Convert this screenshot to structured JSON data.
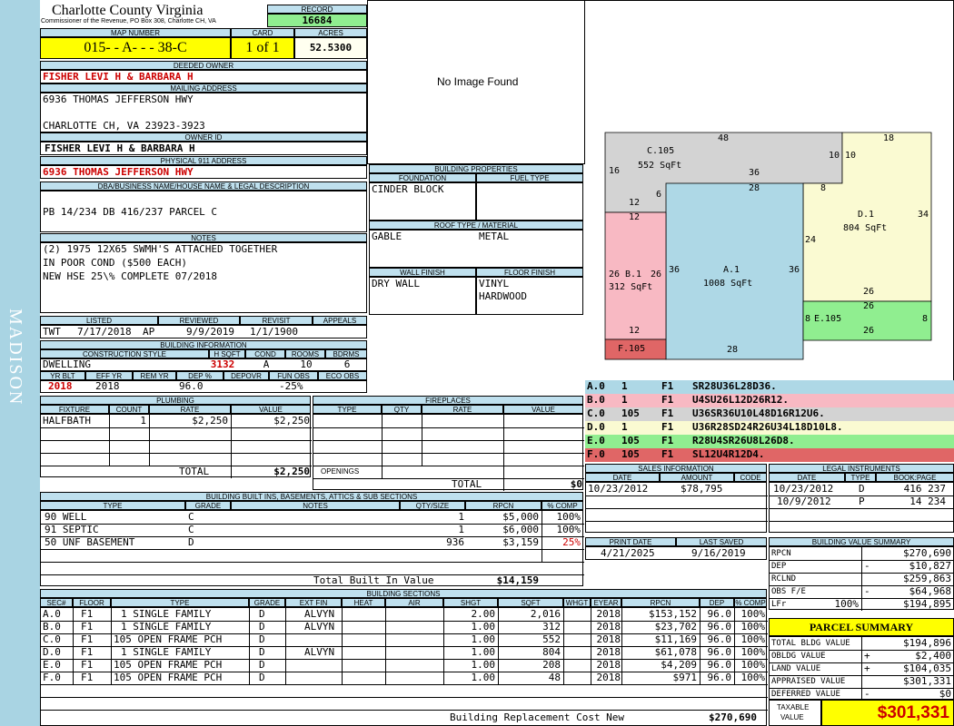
{
  "sidebar": {
    "label": "MADISON"
  },
  "header": {
    "county": "Charlotte County Virginia",
    "commissioner": "Commissioner of the Revenue, PO Box 308, Charlotte CH, VA",
    "record_label": "RECORD",
    "record_value": "16684",
    "map_number_label": "MAP NUMBER",
    "map_number": "015- - A- - - 38-C",
    "card_label": "CARD",
    "card_value": "1 of 1",
    "acres_label": "ACRES",
    "acres_value": "52.5300"
  },
  "owner": {
    "deeded_label": "DEEDED OWNER",
    "deeded_value": "FISHER LEVI H & BARBARA H",
    "mailing_label": "MAILING ADDRESS",
    "mailing_line1": "6936 THOMAS JEFFERSON HWY",
    "mailing_line2": "CHARLOTTE CH, VA 23923-3923",
    "owner_id_label": "OWNER ID",
    "owner_id_value": "FISHER LEVI H & BARBARA H",
    "physical_label": "PHYSICAL 911 ADDRESS",
    "physical_value": "6936 THOMAS JEFFERSON HWY",
    "dba_label": "DBA/BUSINESS NAME/HOUSE NAME & LEGAL DESCRIPTION",
    "dba_value": "PB 14/234 DB 416/237 PARCEL C",
    "notes_label": "NOTES",
    "notes_line1": "(2) 1975 12X65 SWMH'S ATTACHED TOGETHER",
    "notes_line2": "IN POOR COND ($500 EACH)",
    "notes_line3": "NEW HSE 25\\% COMPLETE 07/2018"
  },
  "image": {
    "no_image": "No Image Found"
  },
  "listed": {
    "listed_label": "LISTED",
    "reviewed_label": "REVIEWED",
    "revisit_label": "REVISIT",
    "appeals_label": "APPEALS",
    "listed_by": "TWT",
    "listed_date": "7/17/2018",
    "reviewed_by": "AP",
    "reviewed_date": "9/9/2019",
    "revisit_date": "1/1/1900"
  },
  "building_info": {
    "label": "BUILDING INFORMATION",
    "h_style": "CONSTRUCTION STYLE",
    "h_hsqft": "H SQFT",
    "h_cond": "COND",
    "h_rooms": "ROOMS",
    "h_bdrms": "BDRMS",
    "style": "DWELLING",
    "hsqft": "3132",
    "cond": "A",
    "rooms": "10",
    "bdrms": "6",
    "h_yrblt": "YR BLT",
    "h_effyr": "EFF YR",
    "h_remyr": "REM YR",
    "h_dep": "DEP %",
    "h_depovr": "DEPOVR",
    "h_funobs": "FUN OBS",
    "h_ecoobs": "ECO OBS",
    "yrblt": "2018",
    "effyr": "2018",
    "dep": "96.0",
    "funobs": "-25%"
  },
  "building_props": {
    "label": "BUILDING PROPERTIES",
    "foundation_label": "FOUNDATION",
    "fuel_label": "FUEL TYPE",
    "foundation": "CINDER BLOCK",
    "roof_label": "ROOF TYPE / MATERIAL",
    "roof_type": "GABLE",
    "roof_material": "METAL",
    "wall_label": "WALL FINISH",
    "floor_label": "FLOOR FINISH",
    "wall": "DRY WALL",
    "floor1": "VINYL",
    "floor2": "HARDWOOD"
  },
  "plumbing": {
    "label": "PLUMBING",
    "h_fixture": "FIXTURE",
    "h_count": "COUNT",
    "h_rate": "RATE",
    "h_value": "VALUE",
    "fixture": "HALFBATH",
    "count": "1",
    "rate": "$2,250",
    "value": "$2,250",
    "total_label": "TOTAL",
    "total": "$2,250"
  },
  "fireplaces": {
    "label": "FIREPLACES",
    "h_type": "TYPE",
    "h_qty": "QTY",
    "h_rate": "RATE",
    "h_value": "VALUE",
    "openings_label": "OPENINGS",
    "total_label": "TOTAL",
    "total": "$0"
  },
  "builtins": {
    "label": "BUILDING BUILT INS, BASEMENTS, ATTICS & SUB SECTIONS",
    "h_type": "TYPE",
    "h_grade": "GRADE",
    "h_notes": "NOTES",
    "h_qty": "QTY/SIZE",
    "h_rpcn": "RPCN",
    "h_comp": "% COMP",
    "rows": [
      {
        "type": "90 WELL",
        "grade": "C",
        "qty": "1",
        "rpcn": "$5,000",
        "comp": "100%"
      },
      {
        "type": "91 SEPTIC",
        "grade": "C",
        "qty": "1",
        "rpcn": "$6,000",
        "comp": "100%"
      },
      {
        "type": "50 UNF BASEMENT",
        "grade": "D",
        "qty": "936",
        "rpcn": "$3,159",
        "comp": "25%"
      }
    ],
    "total_label": "Total Built In Value",
    "total": "$14,159"
  },
  "sections": {
    "label": "BUILDING SECTIONS",
    "headers": [
      "SEC#",
      "FLOOR",
      "TYPE",
      "GRADE",
      "EXT FIN",
      "HEAT",
      "AIR",
      "SHGT",
      "SQFT",
      "WHGT",
      "EYEAR",
      "RPCN",
      "DEP",
      "% COMP"
    ],
    "rows": [
      {
        "sec": "A.0",
        "floor": "F1",
        "type": "1 SINGLE FAMILY",
        "grade": "D",
        "ext": "ALVYN",
        "shgt": "2.00",
        "sqft": "2,016",
        "eyear": "2018",
        "rpcn": "$153,152",
        "dep": "96.0",
        "comp": "100%"
      },
      {
        "sec": "B.0",
        "floor": "F1",
        "type": "1 SINGLE FAMILY",
        "grade": "D",
        "ext": "ALVYN",
        "shgt": "1.00",
        "sqft": "312",
        "eyear": "2018",
        "rpcn": "$23,702",
        "dep": "96.0",
        "comp": "100%"
      },
      {
        "sec": "C.0",
        "floor": "F1",
        "type": "105 OPEN FRAME PCH",
        "grade": "D",
        "ext": "",
        "shgt": "1.00",
        "sqft": "552",
        "eyear": "2018",
        "rpcn": "$11,169",
        "dep": "96.0",
        "comp": "100%"
      },
      {
        "sec": "D.0",
        "floor": "F1",
        "type": "1 SINGLE FAMILY",
        "grade": "D",
        "ext": "ALVYN",
        "shgt": "1.00",
        "sqft": "804",
        "eyear": "2018",
        "rpcn": "$61,078",
        "dep": "96.0",
        "comp": "100%"
      },
      {
        "sec": "E.0",
        "floor": "F1",
        "type": "105 OPEN FRAME PCH",
        "grade": "D",
        "ext": "",
        "shgt": "1.00",
        "sqft": "208",
        "eyear": "2018",
        "rpcn": "$4,209",
        "dep": "96.0",
        "comp": "100%"
      },
      {
        "sec": "F.0",
        "floor": "F1",
        "type": "105 OPEN FRAME PCH",
        "grade": "D",
        "ext": "",
        "shgt": "1.00",
        "sqft": "48",
        "eyear": "2018",
        "rpcn": "$971",
        "dep": "96.0",
        "comp": "100%"
      }
    ],
    "total_label": "Building Replacement Cost New",
    "total": "$270,690"
  },
  "sketch": {
    "c_label": "C.105",
    "c_area": "552 SqFt",
    "b_label": "B.1",
    "b_area": "312 SqFt",
    "a_label": "A.1",
    "a_area": "1008 SqFt",
    "d_label": "D.1",
    "d_area": "804 SqFt",
    "e_label": "E.105",
    "f_label": "F.105",
    "dims": {
      "c_top": "48",
      "c_left": "16",
      "c_mid": "36",
      "c_right": "10",
      "c_bot": "12",
      "c_6": "6",
      "d_top": "18",
      "d_left10": "10",
      "d_8": "8",
      "d_right": "34",
      "d_24": "24",
      "d_26": "26",
      "b_top": "12",
      "b_left": "26",
      "b_26": "26",
      "b_bot": "12",
      "a_top": "28",
      "a_left": "36",
      "a_right": "36",
      "a_bot": "28",
      "e_top": "26",
      "e_bot": "26",
      "e_left": "8",
      "e_right": "8"
    }
  },
  "sketch_codes": [
    {
      "sec": "A.0",
      "n": "1",
      "fl": "F1",
      "code": "SR28U36L28D36.",
      "color": "#aed8e6"
    },
    {
      "sec": "B.0",
      "n": "1",
      "fl": "F1",
      "code": "U4SU26L12D26R12.",
      "color": "#f8b9c3"
    },
    {
      "sec": "C.0",
      "n": "105",
      "fl": "F1",
      "code": "U36SR36U10L48D16R12U6.",
      "color": "#d3d3d3"
    },
    {
      "sec": "D.0",
      "n": "1",
      "fl": "F1",
      "code": "U36R28SD24R26U34L18D10L8.",
      "color": "#fafad2"
    },
    {
      "sec": "E.0",
      "n": "105",
      "fl": "F1",
      "code": "R28U4SR26U8L26D8.",
      "color": "#90ee90"
    },
    {
      "sec": "F.0",
      "n": "105",
      "fl": "F1",
      "code": "SL12U4R12D4.",
      "color": "#e06666"
    }
  ],
  "sales": {
    "label": "SALES INFORMATION",
    "h_date": "DATE",
    "h_amount": "AMOUNT",
    "h_code": "CODE",
    "date": "10/23/2012",
    "amount": "$78,795"
  },
  "legal": {
    "label": "LEGAL INSTRUMENTS",
    "h_date": "DATE",
    "h_type": "TYPE",
    "h_book": "BOOK:PAGE",
    "rows": [
      {
        "date": "10/23/2012",
        "type": "D",
        "book": "416 237"
      },
      {
        "date": "10/9/2012",
        "type": "P",
        "book": "14 234"
      }
    ]
  },
  "print": {
    "print_label": "PRINT DATE",
    "saved_label": "LAST SAVED",
    "print_date": "4/21/2025",
    "saved_date": "9/16/2019"
  },
  "value_summary": {
    "label": "BUILDING VALUE SUMMARY",
    "rpcn_label": "RPCN",
    "rpcn": "$270,690",
    "dep_label": "DEP",
    "dep": "$10,827",
    "rclnd_label": "RCLND",
    "rclnd": "$259,863",
    "obs_label": "OBS F/E",
    "obs": "$64,968",
    "lfr_label": "LFr",
    "lfr_pct": "100%",
    "lfr": "$194,895",
    "minus": "-"
  },
  "parcel": {
    "label": "PARCEL SUMMARY",
    "bldg_label": "TOTAL BLDG VALUE",
    "bldg": "$194,896",
    "obldg_label": "OBLDG VALUE",
    "obldg": "$2,400",
    "land_label": "LAND VALUE",
    "land": "$104,035",
    "appraised_label": "APPRAISED VALUE",
    "appraised": "$301,331",
    "deferred_label": "DEFERRED VALUE",
    "deferred": "$0",
    "taxable_label1": "TAXABLE",
    "taxable_label2": "VALUE",
    "taxable": "$301,331",
    "plus": "+",
    "minus": "-"
  }
}
